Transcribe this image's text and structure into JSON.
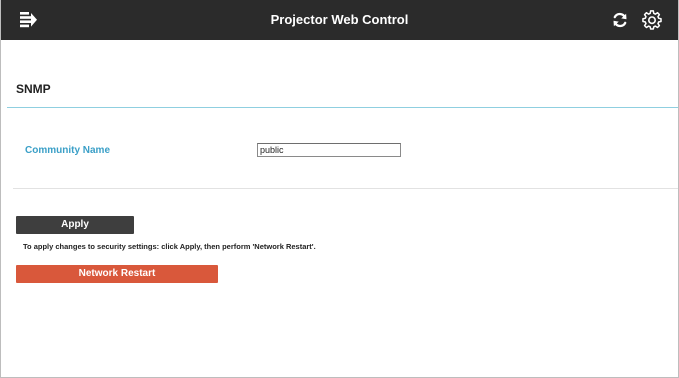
{
  "header": {
    "title": "Projector Web Control",
    "background": "#2b2b2b",
    "icons": [
      "menu-icon",
      "refresh-icon",
      "gear-icon"
    ]
  },
  "section": {
    "title": "SNMP",
    "divider_color": "#8fcfe0"
  },
  "form": {
    "community_name_label": "Community Name",
    "community_name_value": "public",
    "label_color": "#3a9fc7"
  },
  "actions": {
    "apply_label": "Apply",
    "apply_color": "#3e3e3e",
    "help_text": "To apply changes to security settings: click Apply, then perform 'Network Restart'.",
    "restart_label": "Network Restart",
    "restart_color": "#d9583b"
  }
}
